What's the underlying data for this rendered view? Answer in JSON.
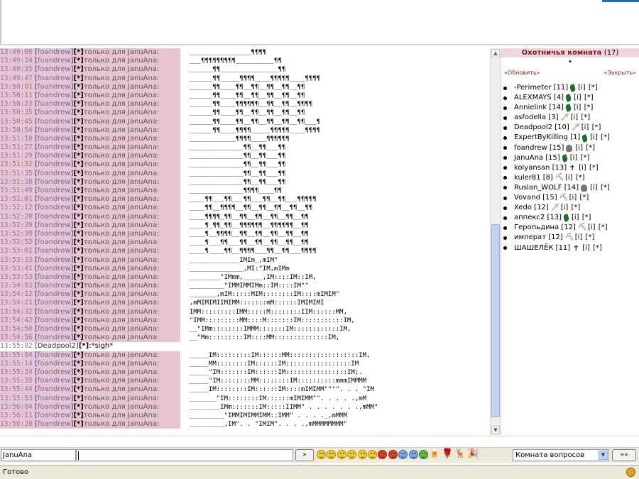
{
  "chat": {
    "messages": [
      {
        "time": "13:49:09",
        "nick": "foandrew",
        "target": "только для JanuAna:",
        "art": "  ________________¶¶¶¶"
      },
      {
        "time": "13:49:24",
        "nick": "foandrew",
        "target": "только для JanuAna:",
        "art": "  ___¶¶¶¶¶¶¶¶¶__________¶¶"
      },
      {
        "time": "13:49:35",
        "nick": "foandrew",
        "target": "только для JanuAna:",
        "art": "  ______¶¶_______________¶¶"
      },
      {
        "time": "13:49:47",
        "nick": "foandrew",
        "target": "только для JanuAna:",
        "art": "  ______¶¶_____¶¶¶¶____¶¶¶¶¶____¶¶¶¶"
      },
      {
        "time": "13:50:01",
        "nick": "foandrew",
        "target": "только для JanuAna:",
        "art": "  ______¶¶____¶¶__¶¶__¶¶__¶¶__¶¶"
      },
      {
        "time": "13:50:11",
        "nick": "foandrew",
        "target": "только для JanuAna:",
        "art": "  ______¶¶____¶¶__¶¶__¶¶__¶¶__¶¶"
      },
      {
        "time": "13:50:23",
        "nick": "foandrew",
        "target": "только для JanuAna:",
        "art": "  ______¶¶____¶¶¶¶¶¶__¶¶__¶¶__¶¶¶¶"
      },
      {
        "time": "13:50:35",
        "nick": "foandrew",
        "target": "только для JanuAna:",
        "art": "  ______¶¶____¶¶__¶¶__¶¶__¶¶__¶¶"
      },
      {
        "time": "13:50:45",
        "nick": "foandrew",
        "target": "только для JanuAna:",
        "art": "  ______¶¶____¶¶__¶¶__¶¶__¶¶__¶¶___¶"
      },
      {
        "time": "13:50:54",
        "nick": "foandrew",
        "target": "только для JanuAna:",
        "art": "  ______¶¶____¶¶¶¶_____¶¶¶¶¶____¶¶¶¶"
      },
      {
        "time": "13:51:10",
        "nick": "foandrew",
        "target": "только для JanuAna:",
        "art": "  ____________¶¶¶¶____¶¶¶¶¶¶"
      },
      {
        "time": "13:51:27",
        "nick": "foandrew",
        "target": "только для JanuAna:",
        "art": "  ______________¶¶__¶¶___¶¶"
      },
      {
        "time": "13:51:29",
        "nick": "foandrew",
        "target": "только для JanuAna:",
        "art": "  ______________¶¶__¶¶___¶¶"
      },
      {
        "time": "13:51:32",
        "nick": "foandrew",
        "target": "только для JanuAna:",
        "art": "  ______________¶¶__¶¶___¶¶"
      },
      {
        "time": "13:51:35",
        "nick": "foandrew",
        "target": "только для JanuAna:",
        "art": "  ______________¶¶__¶¶___¶¶"
      },
      {
        "time": "13:51:38",
        "nick": "foandrew",
        "target": "только для JanuAna:",
        "art": "  ______________¶¶__¶¶___¶¶"
      },
      {
        "time": "13:51:49",
        "nick": "foandrew",
        "target": "только для JanuAna:",
        "art": "  ______________¶¶¶¶____¶¶"
      },
      {
        "time": "13:52:01",
        "nick": "foandrew",
        "target": "только для JanuAna:",
        "art": "  ____¶¶___¶¶___¶¶___¶¶__¶¶___¶¶¶¶¶"
      },
      {
        "time": "13:52:12",
        "nick": "foandrew",
        "target": "только для JanuAna:",
        "art": "  ____¶¶__¶¶¶¶__¶¶__¶¶__¶¶__¶¶__¶¶"
      },
      {
        "time": "13:52:20",
        "nick": "foandrew",
        "target": "только для JanuAna:",
        "art": "  ____¶¶¶¶_¶¶__¶¶__¶¶__¶¶__¶¶__¶¶"
      },
      {
        "time": "13:52:29",
        "nick": "foandrew",
        "target": "только для JanuAna:",
        "art": "  ____¶_¶¶_¶¶__¶¶¶¶¶¶__¶¶¶¶¶¶__¶¶"
      },
      {
        "time": "13:52:39",
        "nick": "foandrew",
        "target": "только для JanuAna:",
        "art": "  ____¶__¶¶¶¶__¶¶__¶¶__¶¶__¶¶__¶¶"
      },
      {
        "time": "13:52:52",
        "nick": "foandrew",
        "target": "только для JanuAna:",
        "art": "  ____¶___¶¶___¶¶__¶¶__¶¶__¶¶__¶¶"
      },
      {
        "time": "13:53:01",
        "nick": "foandrew",
        "target": "только для JanuAna:",
        "art": "  ____¶____¶¶__¶¶¶¶___¶¶__¶¶___¶¶¶¶"
      },
      {
        "time": "13:53:33",
        "nick": "foandrew",
        "target": "только для JanuAna:",
        "art": "  _____________IMIm_,mIM\""
      },
      {
        "time": "13:53:41",
        "nick": "foandrew",
        "target": "только для JanuAna:",
        "art": "  ______________,MI:\"IM,mIMm"
      },
      {
        "time": "13:53:53",
        "nick": "foandrew",
        "target": "только для JanuAna:",
        "art": "  ________\"IMmm,_____,IM::::IM::IM,"
      },
      {
        "time": "13:54:03",
        "nick": "foandrew",
        "target": "только для JanuAna:",
        "art": "  _________\"IMMIMMIMm::IM::::IM\"\""
      },
      {
        "time": "13:54:12",
        "nick": "foandrew",
        "target": "только для JanuAna:",
        "art": "  _______,mIM:::::MIM::::::::IM::::mIMIM\""
      },
      {
        "time": "13:54:21",
        "nick": "foandrew",
        "target": "только для JanuAna:",
        "art": "  ,mMIMIMIIMIMM:::::::mM::::::IMIMIMI"
      },
      {
        "time": "13:54:32",
        "nick": "foandrew",
        "target": "только для JanuAna:",
        "art": "  IMM:::::::::IMM:::::M::::::::IIM::::::MM,"
      },
      {
        "time": "13:54:42",
        "nick": "foandrew",
        "target": "только для JanuAna:",
        "art": "  \"IMM:::::::::MM::::M:::::::IM:::::::::::IM,"
      },
      {
        "time": "13:54:50",
        "nick": "foandrew",
        "target": "только для JanuAna:",
        "art": "  __\"IMm::::::::IMMM:::::::IM::::::::::::IM,"
      },
      {
        "time": "13:54:56",
        "nick": "foandrew",
        "target": "только для JanuAna:",
        "art": "  __\"Mm:::::::::IM::::MM::::::::::::::IM,"
      },
      {
        "time": "13:55:02",
        "nick": "Deadpool2",
        "target": "",
        "art": "*sigh*",
        "normal": true
      },
      {
        "time": "13:55:04",
        "nick": "foandrew",
        "target": "только для JanuAna:",
        "art": "  _____IM:::::::::IM::::::MM::::::::::::::::::IM,"
      },
      {
        "time": "13:55:14",
        "nick": "foandrew",
        "target": "только для JanuAna:",
        "art": "  _____MM::::::::IM::::::IM:::::::::::::::::IM"
      },
      {
        "time": "13:55:24",
        "nick": "foandrew",
        "target": "только для JanuAna:",
        "art": "  _____\"IM:::::::IM::::::IM::::::::::::::::IM;."
      },
      {
        "time": "13:55:35",
        "nick": "foandrew",
        "target": "только для JanuAna:",
        "art": "  _____\"IM::::::::MM::::::::IM::::::::::mmmIMMMM"
      },
      {
        "time": "13:55:44",
        "nick": "foandrew",
        "target": "только для JanuAna:",
        "art": "  _____IM::::::::IM::::::IM::::mIMIMM\"\"\"\". . . \"IM"
      },
      {
        "time": "13:55:53",
        "nick": "foandrew",
        "target": "только для JanuAna:",
        "art": "  _______\"IM::::::::IM::::::mIMIMM\"\". . . . .,mM"
      },
      {
        "time": "13:56:04",
        "nick": "foandrew",
        "target": "только для JanuAna:",
        "art": "  ________IMm:::::::IM:::::IIMM\" . . . . . . .,mMM\""
      },
      {
        "time": "13:56:11",
        "nick": "foandrew",
        "target": "только для JanuAna:",
        "art": "  _________\"IMMIMIMMIMM::IMM\" . . . ._,mMMM"
      },
      {
        "time": "13:56:20",
        "nick": "foandrew",
        "target": "только для JanuAna:",
        "art": "  _________,IM\". . \"IMIM\". . . .,mMMMMMMMM\""
      }
    ]
  },
  "room": {
    "title": "Охотничья комната",
    "count": "(17)",
    "dot": "•",
    "refresh_label": "«Обновить»",
    "close_label": "«Закрыть»",
    "users": [
      {
        "name": "-Perimeter",
        "level": "[11]",
        "icon": "leaf-icon"
      },
      {
        "name": "ALEXMAYS",
        "level": "[4]",
        "icon": "leaf-icon"
      },
      {
        "name": "Annielink",
        "level": "[14]",
        "icon": "leaf-icon"
      },
      {
        "name": "asfodella",
        "level": "[3]",
        "icon": "dagger-icon"
      },
      {
        "name": "Deadpool2",
        "level": "[10]",
        "icon": "dagger-icon"
      },
      {
        "name": "ExpertByKilling",
        "level": "[1]",
        "icon": "leaf-icon"
      },
      {
        "name": "foandrew",
        "level": "[15]",
        "icon": "helmet-icon"
      },
      {
        "name": "JanuAna",
        "level": "[15]",
        "icon": "leaf-icon"
      },
      {
        "name": "kolyansan",
        "level": "[13]",
        "icon": "cross-icon"
      },
      {
        "name": "kuler81",
        "level": "[8]",
        "icon": "pickaxe-icon"
      },
      {
        "name": "Ruslan_WOLF",
        "level": "[14]",
        "icon": "helmet-icon"
      },
      {
        "name": "Vovand",
        "level": "[15]",
        "icon": "pickaxe-icon"
      },
      {
        "name": "Xedo",
        "level": "[12]",
        "icon": "dagger-icon"
      },
      {
        "name": "аппекс2",
        "level": "[13]",
        "icon": "leaf-icon"
      },
      {
        "name": "Геропьдина",
        "level": "[12]",
        "icon": "pickaxe-icon"
      },
      {
        "name": "императ",
        "level": "[12]",
        "icon": "pickaxe-icon"
      },
      {
        "name": "ШАШЕЛЁК",
        "level": "[11]",
        "icon": "cross-icon"
      }
    ],
    "info_tag": "[i]",
    "private_tag": "[*]"
  },
  "input": {
    "nick_value": "JanuAna",
    "message_value": "",
    "send_label": "»",
    "room_select_value": "Комната вопросов",
    "go_label": "»»",
    "smileys": [
      "smile-icon",
      "grin-icon",
      "laugh-icon",
      "wink-icon",
      "tongue-icon",
      "cool-icon",
      "angry-icon",
      "sad-icon",
      "crying-icon",
      "confused-icon",
      "shocked-icon",
      "beer-icon",
      "rose-icon",
      "moose-icon",
      "party-icon"
    ]
  },
  "status": {
    "text": "Готово"
  },
  "colors": {
    "highlight": "#e8c3d1",
    "room_header": "#f0d6dc",
    "room_title": "#7a1a1a",
    "scroll_thumb": "#c4d2f4"
  }
}
